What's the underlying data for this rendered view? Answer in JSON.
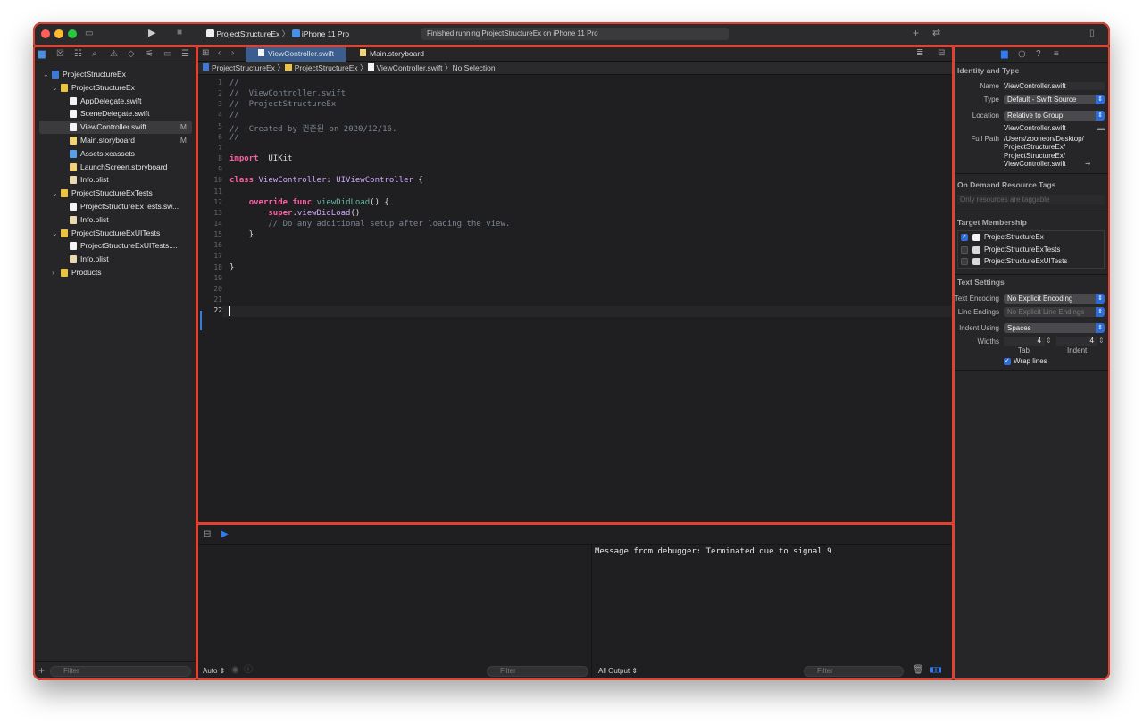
{
  "toolbar": {
    "scheme": "ProjectStructureEx",
    "device": "iPhone 11 Pro",
    "status": "Finished running ProjectStructureEx on iPhone 11 Pro"
  },
  "navigator": {
    "items": [
      {
        "label": "ProjectStructureEx",
        "depth": 0,
        "icon": "project",
        "chev": "v"
      },
      {
        "label": "ProjectStructureEx",
        "depth": 1,
        "icon": "folder",
        "chev": "v"
      },
      {
        "label": "AppDelegate.swift",
        "depth": 2,
        "icon": "swift"
      },
      {
        "label": "SceneDelegate.swift",
        "depth": 2,
        "icon": "swift"
      },
      {
        "label": "ViewController.swift",
        "depth": 2,
        "icon": "swift",
        "mod": "M",
        "selected": true
      },
      {
        "label": "Main.storyboard",
        "depth": 2,
        "icon": "storyboard",
        "mod": "M"
      },
      {
        "label": "Assets.xcassets",
        "depth": 2,
        "icon": "asset"
      },
      {
        "label": "LaunchScreen.storyboard",
        "depth": 2,
        "icon": "storyboard"
      },
      {
        "label": "Info.plist",
        "depth": 2,
        "icon": "plist"
      },
      {
        "label": "ProjectStructureExTests",
        "depth": 1,
        "icon": "folder",
        "chev": "v"
      },
      {
        "label": "ProjectStructureExTests.sw...",
        "depth": 2,
        "icon": "swift"
      },
      {
        "label": "Info.plist",
        "depth": 2,
        "icon": "plist"
      },
      {
        "label": "ProjectStructureExUITests",
        "depth": 1,
        "icon": "folder",
        "chev": "v"
      },
      {
        "label": "ProjectStructureExUITests....",
        "depth": 2,
        "icon": "swift"
      },
      {
        "label": "Info.plist",
        "depth": 2,
        "icon": "plist"
      },
      {
        "label": "Products",
        "depth": 1,
        "icon": "folder",
        "chev": ">"
      }
    ],
    "filter_placeholder": "Filter"
  },
  "editor": {
    "tab_active": "ViewController.swift",
    "tab_other": "Main.storyboard",
    "jump": [
      "ProjectStructureEx",
      "ProjectStructureEx",
      "ViewController.swift",
      "No Selection"
    ],
    "lines": [
      [
        [
          "c",
          "//"
        ]
      ],
      [
        [
          "c",
          "//  ViewController.swift"
        ]
      ],
      [
        [
          "c",
          "//  ProjectStructureEx"
        ]
      ],
      [
        [
          "c",
          "//"
        ]
      ],
      [
        [
          "c",
          "//  Created by 권준원 on 2020/12/16."
        ]
      ],
      [
        [
          "c",
          "//"
        ]
      ],
      [],
      [
        [
          "k",
          "import"
        ],
        [
          "",
          "  UIKit"
        ]
      ],
      [],
      [
        [
          "k",
          "class"
        ],
        [
          "",
          " "
        ],
        [
          "t",
          "ViewController"
        ],
        [
          "",
          ": "
        ],
        [
          "t",
          "UIViewController"
        ],
        [
          "",
          " {"
        ]
      ],
      [],
      [
        [
          "",
          "    "
        ],
        [
          "k",
          "override func"
        ],
        [
          "",
          " "
        ],
        [
          "f",
          "viewDidLoad"
        ],
        [
          "",
          "() {"
        ]
      ],
      [
        [
          "",
          "        "
        ],
        [
          "k",
          "super"
        ],
        [
          "",
          "."
        ],
        [
          "t",
          "viewDidLoad"
        ],
        [
          "",
          "()"
        ]
      ],
      [
        [
          "",
          "        "
        ],
        [
          "c",
          "// Do any additional setup after loading the view."
        ]
      ],
      [
        [
          "",
          "    }"
        ]
      ],
      [],
      [],
      [
        [
          "",
          "}"
        ]
      ],
      [],
      [],
      [],
      []
    ]
  },
  "debug": {
    "console": "Message from debugger: Terminated due to signal 9",
    "auto": "Auto ⇕",
    "all_output": "All Output ⇕",
    "filter": "Filter"
  },
  "inspector": {
    "identity_title": "Identity and Type",
    "name_label": "Name",
    "name": "ViewController.swift",
    "type_label": "Type",
    "type": "Default - Swift Source",
    "location_label": "Location",
    "location": "Relative to Group",
    "location_file": "ViewController.swift",
    "fullpath_label": "Full Path",
    "fullpath": [
      "/Users/zooneon/Desktop/",
      "ProjectStructureEx/",
      "ProjectStructureEx/",
      "ViewController.swift"
    ],
    "odr_title": "On Demand Resource Tags",
    "odr_placeholder": "Only resources are taggable",
    "target_title": "Target Membership",
    "targets": [
      {
        "name": "ProjectStructureEx",
        "on": true
      },
      {
        "name": "ProjectStructureExTests",
        "on": false
      },
      {
        "name": "ProjectStructureExUITests",
        "on": false
      }
    ],
    "text_title": "Text Settings",
    "enc_label": "Text Encoding",
    "enc": "No Explicit Encoding",
    "le_label": "Line Endings",
    "le": "No Explicit Line Endings",
    "indent_label": "Indent Using",
    "indent": "Spaces",
    "widths_label": "Widths",
    "tab_w": "4",
    "indent_w": "4",
    "tab_cap": "Tab",
    "indent_cap": "Indent",
    "wrap": "Wrap lines"
  }
}
